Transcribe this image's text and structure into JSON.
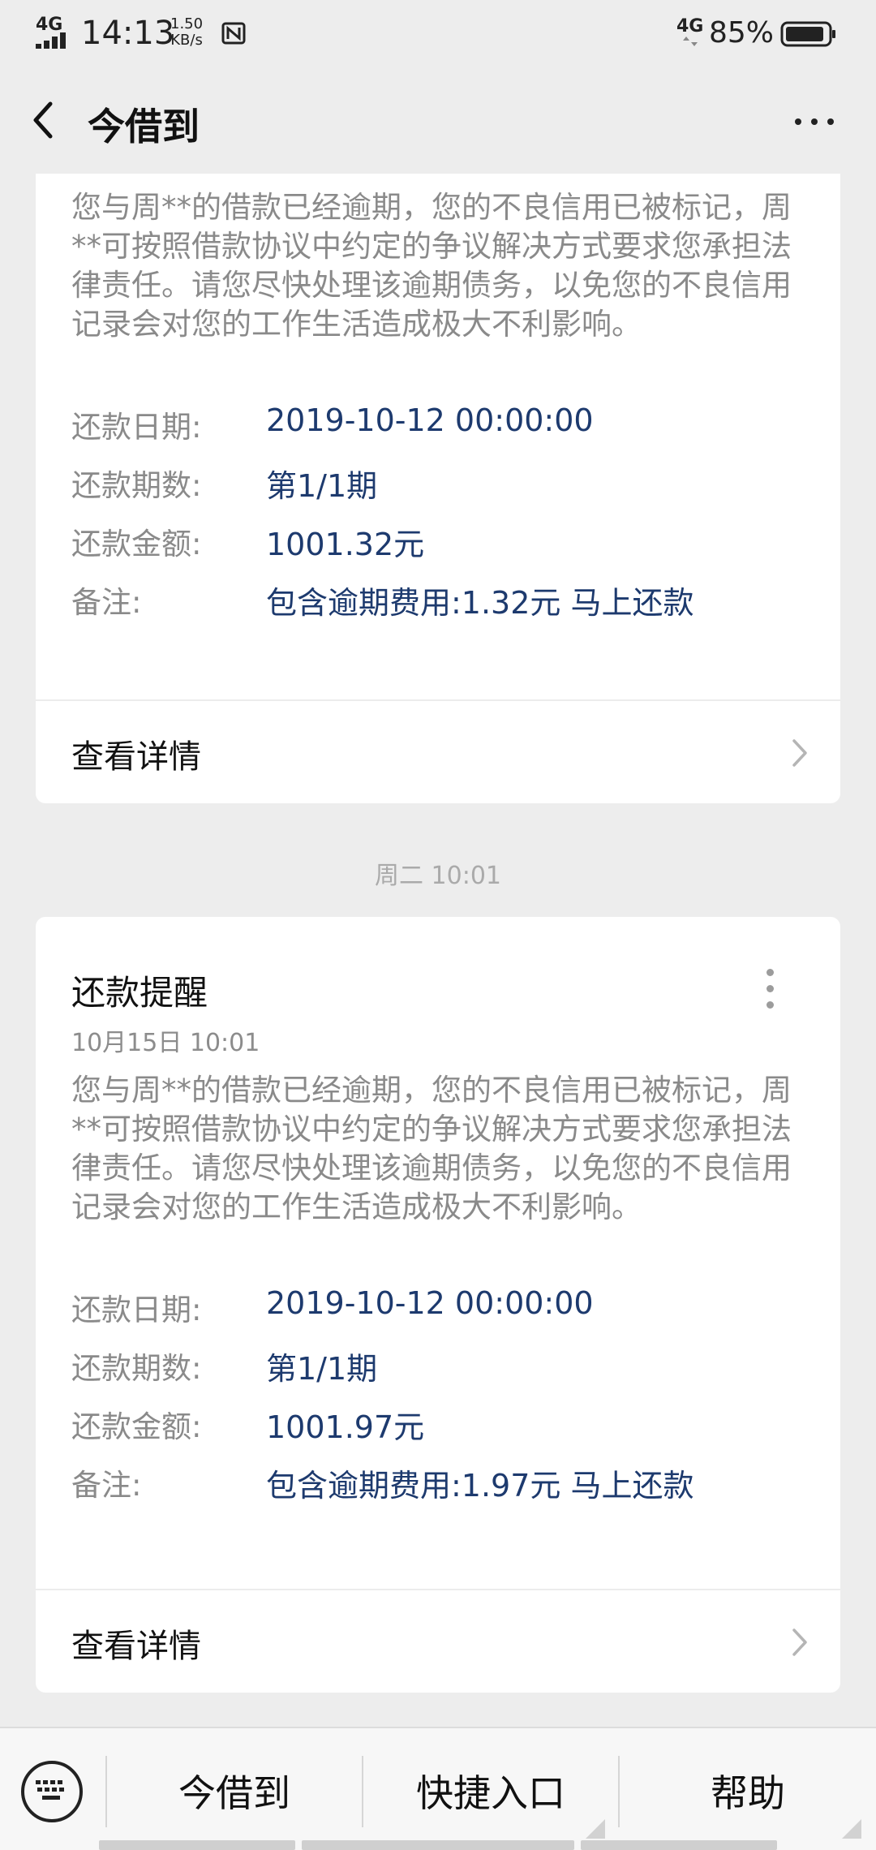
{
  "status_bar": {
    "network": "4G",
    "time": "14:13",
    "speed_value": "1.50",
    "speed_unit": "KB/s",
    "network_right": "4G",
    "battery": "85%"
  },
  "nav": {
    "title": "今借到",
    "back_icon": "chevron-left-icon",
    "more_icon": "more-horizontal-icon"
  },
  "cards": [
    {
      "message": "您与周**的借款已经逾期，您的不良信用已被标记，周**可按照借款协议中约定的争议解决方式要求您承担法律责任。请您尽快处理该逾期债务，以免您的不良信用记录会对您的工作生活造成极大不利影响。",
      "fields": [
        {
          "label": "还款日期:",
          "value": "2019-10-12 00:00:00"
        },
        {
          "label": "还款期数:",
          "value": "第1/1期"
        },
        {
          "label": "还款金额:",
          "value": "1001.32元"
        },
        {
          "label": "备注:",
          "value": "包含逾期费用:1.32元 马上还款"
        }
      ],
      "details_label": "查看详情"
    },
    {
      "title": "还款提醒",
      "date": "10月15日  10:01",
      "message": "您与周**的借款已经逾期，您的不良信用已被标记，周**可按照借款协议中约定的争议解决方式要求您承担法律责任。请您尽快处理该逾期债务，以免您的不良信用记录会对您的工作生活造成极大不利影响。",
      "fields": [
        {
          "label": "还款日期:",
          "value": "2019-10-12 00:00:00"
        },
        {
          "label": "还款期数:",
          "value": "第1/1期"
        },
        {
          "label": "还款金额:",
          "value": "1001.97元"
        },
        {
          "label": "备注:",
          "value": "包含逾期费用:1.97元 马上还款"
        }
      ],
      "details_label": "查看详情"
    }
  ],
  "time_divider": "周二 10:01",
  "bottom_menu": {
    "keyboard_icon": "keyboard-icon",
    "items": [
      "今借到",
      "快捷入口",
      "帮助"
    ]
  },
  "colors": {
    "background": "#ededed",
    "card": "#ffffff",
    "value_text": "#1d3a6e",
    "muted_text": "#8a8a8a"
  }
}
